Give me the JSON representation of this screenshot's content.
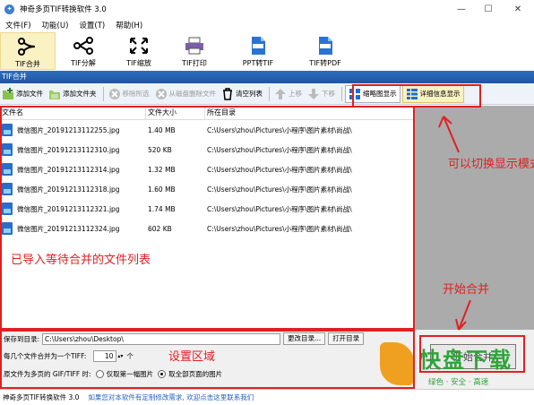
{
  "window": {
    "title": "神奇多页TIF转换软件 3.0"
  },
  "menu": [
    "文件(F)",
    "功能(U)",
    "设置(T)",
    "帮助(H)"
  ],
  "toolbar": [
    {
      "label": "TIF合并",
      "icon": "merge-icon",
      "active": true
    },
    {
      "label": "TIF分解",
      "icon": "split-icon",
      "active": false
    },
    {
      "label": "TIF缩放",
      "icon": "resize-icon",
      "active": false
    },
    {
      "label": "TIF打印",
      "icon": "print-icon",
      "active": false
    },
    {
      "label": "PPT转TIF",
      "icon": "ppt-icon",
      "active": false
    },
    {
      "label": "TIF转PDF",
      "icon": "pdf-icon",
      "active": false
    }
  ],
  "section_title": "TIF合并",
  "subtoolbar": {
    "add_file": "添加文件",
    "add_folder": "添加文件夹",
    "remove_selected": "移除所选",
    "remove_from_disk": "从磁盘删除文件",
    "clear_list": "清空列表",
    "move_up": "上移",
    "move_down": "下移",
    "thumbnail_view": "缩略图显示",
    "detail_view": "详细信息显示"
  },
  "table": {
    "headers": [
      "文件名",
      "文件大小",
      "所在目录"
    ],
    "rows": [
      {
        "name": "微信图片_20191213112255.jpg",
        "size": "1.40 MB",
        "dir": "C:\\Users\\zhou\\Pictures\\小程序\\图片素材\\尚战\\"
      },
      {
        "name": "微信图片_20191213112310.jpg",
        "size": "520 KB",
        "dir": "C:\\Users\\zhou\\Pictures\\小程序\\图片素材\\尚战\\"
      },
      {
        "name": "微信图片_20191213112314.jpg",
        "size": "1.32 MB",
        "dir": "C:\\Users\\zhou\\Pictures\\小程序\\图片素材\\尚战\\"
      },
      {
        "name": "微信图片_20191213112318.jpg",
        "size": "1.60 MB",
        "dir": "C:\\Users\\zhou\\Pictures\\小程序\\图片素材\\尚战\\"
      },
      {
        "name": "微信图片_20191213112321.jpg",
        "size": "1.74 MB",
        "dir": "C:\\Users\\zhou\\Pictures\\小程序\\图片素材\\尚战\\"
      },
      {
        "name": "微信图片_20191213112324.jpg",
        "size": "602 KB",
        "dir": "C:\\Users\\zhou\\Pictures\\小程序\\图片素材\\尚战\\"
      }
    ]
  },
  "annotations": {
    "switch_mode": "可以切换显示模式",
    "file_list": "已导入等待合并的文件列表",
    "start_merge": "开始合并",
    "settings_area": "设置区域"
  },
  "settings": {
    "save_label": "保存到目录:",
    "save_path": "C:\\Users\\zhou\\Desktop\\",
    "change_dir": "更改目录...",
    "open_dir": "打开目录",
    "per_tiff_label": "每几个文件合并为一个TIFF:",
    "per_tiff_value": "10",
    "per_tiff_unit": "个",
    "multi_label": "原文件为多页的 GIF/TIFF 时:",
    "opt_first": "仅取第一幅图片",
    "opt_all": "取全部页面的图片"
  },
  "start_button": "开始合并",
  "statusbar": {
    "left": "神奇多页TIF转换软件 3.0",
    "link": "如果您对本软件有定制修改需求, 欢迎点击这里联系我们"
  },
  "watermark": {
    "title": "快盘下载",
    "sub": "绿色 · 安全 · 高速"
  },
  "colors": {
    "accent": "#2e6fbf",
    "annotation": "#e02020",
    "watermark": "#2ea43a"
  }
}
